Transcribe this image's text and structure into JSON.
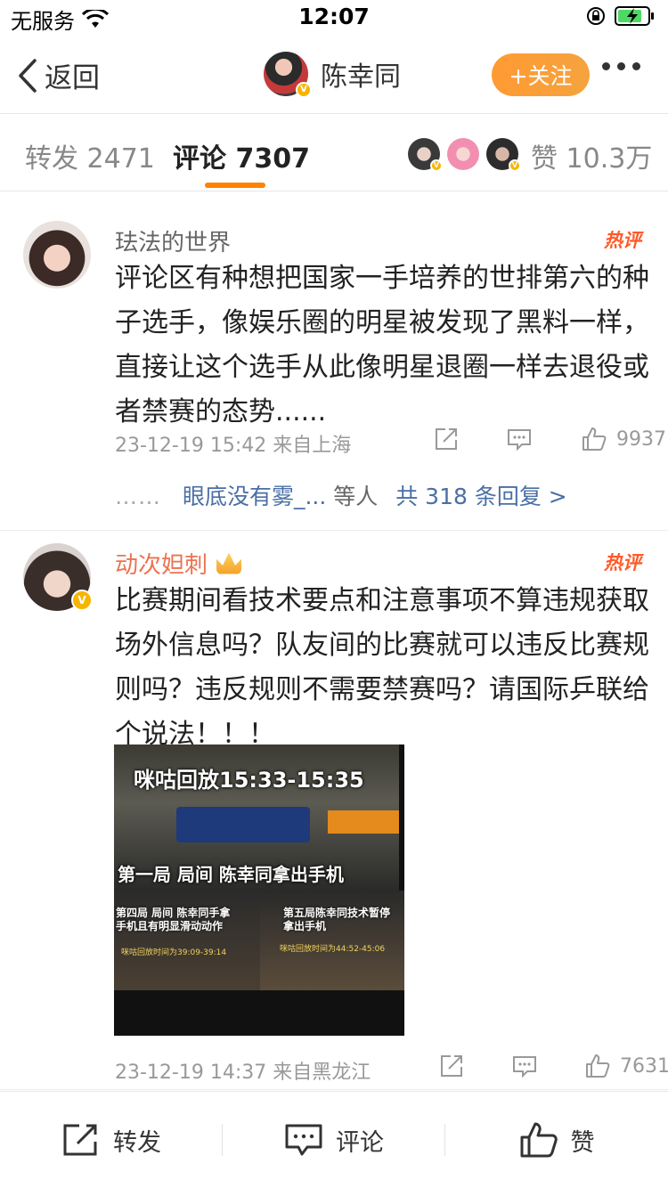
{
  "status_bar": {
    "carrier": "无服务",
    "time": "12:07"
  },
  "nav": {
    "back_label": "返回",
    "title": "陈幸同",
    "follow_label": "+关注"
  },
  "tabs": {
    "repost": "转发 2471",
    "comment": "评论 7307",
    "likes": "赞 10.3万"
  },
  "comments": [
    {
      "user": "珐法的世界",
      "hot": "热评",
      "text": "评论区有种想把国家一手培养的世排第六的种子选手，像娱乐圈的明星被发现了黑料一样，直接让这个选手从此像明星退圈一样去退役或者禁赛的态势......",
      "meta": "23-12-19 15:42  来自上海",
      "likes": "9937",
      "replies": {
        "dots": "……",
        "names": "眼底没有雾_...",
        "others": "等人",
        "count_link": "共 318 条回复 >"
      }
    },
    {
      "user": "动次妲刺",
      "hot": "热评",
      "text": "比赛期间看技术要点和注意事项不算违规获取场外信息吗？队友间的比赛就可以违反比赛规则吗？违反规则不需要禁赛吗？请国际乒联给个说法！！！",
      "image": {
        "caption_top": "咪咕回放15:33-15:35",
        "caption_mid": "第一局 局间 陈幸同拿出手机",
        "caption_bl": "第四局 局间 陈幸同手拿\n手机且有明显滑动动作",
        "caption_br": "第五局陈幸同技术暂停\n拿出手机",
        "small_bl": "咪咕回放时间为39:09-39:14",
        "small_br": "咪咕回放时间为44:52-45:06"
      },
      "meta": "23-12-19 14:37  来自黑龙江",
      "likes": "7631"
    }
  ],
  "bottom_bar": {
    "repost": "转发",
    "comment": "评论",
    "like": "赞"
  },
  "colors": {
    "accent": "#ff8200",
    "link": "#4a6fa5",
    "hot": "#ff5a2a",
    "vip_name": "#eb7350"
  }
}
